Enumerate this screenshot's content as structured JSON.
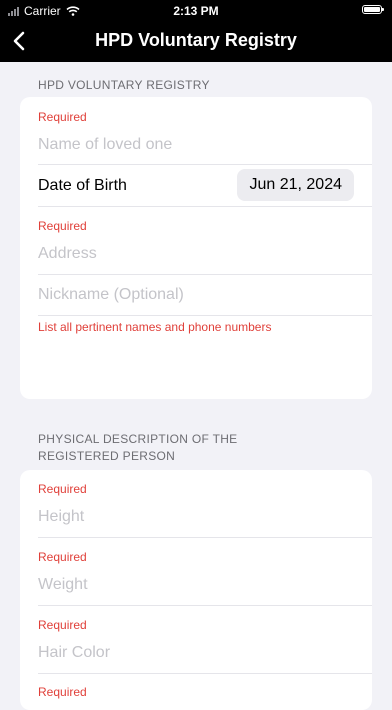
{
  "status_bar": {
    "carrier": "Carrier",
    "time": "2:13 PM"
  },
  "nav": {
    "title": "HPD Voluntary Registry",
    "back_icon": "chevron-left-icon"
  },
  "section1": {
    "header": "HPD VOLUNTARY REGISTRY",
    "name": {
      "required": "Required",
      "placeholder": "Name of loved one"
    },
    "dob": {
      "label": "Date of Birth",
      "value": "Jun 21, 2024"
    },
    "address": {
      "required": "Required",
      "placeholder": "Address"
    },
    "nickname": {
      "placeholder": "Nickname (Optional)",
      "hint": "List all pertinent names and phone numbers"
    }
  },
  "section2": {
    "header_line1": "PHYSICAL DESCRIPTION OF THE",
    "header_line2": "REGISTERED PERSON",
    "height": {
      "required": "Required",
      "placeholder": "Height"
    },
    "weight": {
      "required": "Required",
      "placeholder": "Weight"
    },
    "hair": {
      "required": "Required",
      "placeholder": "Hair Color"
    },
    "next": {
      "required": "Required"
    }
  },
  "colors": {
    "required": "#e0403a",
    "placeholder": "#c4c4c9",
    "background": "#f2f2f7"
  }
}
